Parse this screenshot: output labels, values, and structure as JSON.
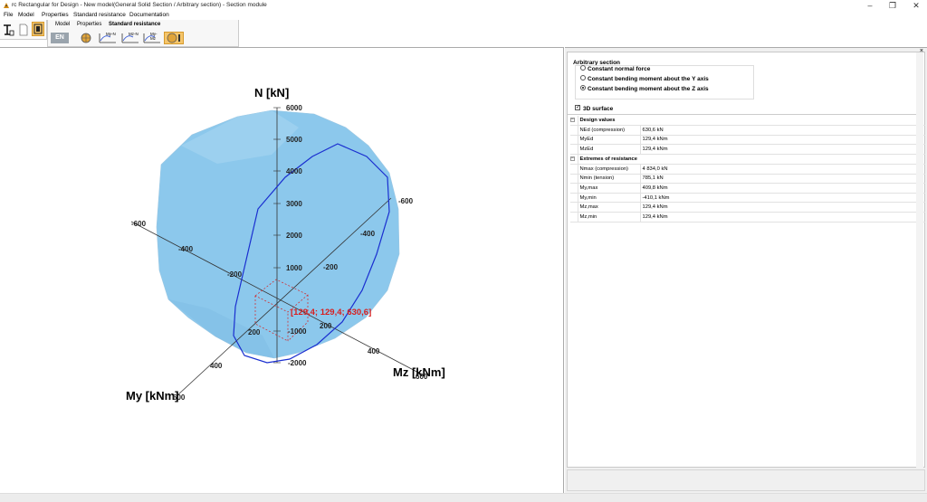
{
  "window": {
    "title": "rc Rectangular for Design - New model(General Solid Section / Arbitrary section) - Section module",
    "minimize": "–",
    "maximize": "❐",
    "close": "✕"
  },
  "menu": [
    "File",
    "Model",
    "Properties",
    "Standard resistance",
    "Documentation"
  ],
  "ribbon": {
    "tabs": [
      "Model",
      "Properties",
      "Standard resistance"
    ],
    "language": "EN",
    "icon_labels": [
      "My-N",
      "Mz-N",
      "My-Mz"
    ]
  },
  "chart": {
    "n_axis_label": "N [kN]",
    "my_axis_label": "My [kNm]",
    "mz_axis_label": "Mz [kNm]",
    "n_ticks": [
      "6000",
      "5000",
      "4000",
      "3000",
      "2000",
      "1000",
      "-1000",
      "-2000"
    ],
    "my_ticks": [
      "-600",
      "-400",
      "-200",
      "200",
      "400",
      "600"
    ],
    "mz_ticks": [
      "-600",
      "-400",
      "-200",
      "200",
      "400",
      "600"
    ],
    "point_label": "[129,4; 129,4; 630,6]",
    "surface_color": "#8cc8ec",
    "curve_color": "#1a2fd0",
    "point_color": "#d81e1e"
  },
  "panel": {
    "group_title": "Arbitrary section",
    "options": [
      {
        "label": "Constant normal force",
        "selected": false
      },
      {
        "label": "Constant bending moment about the Y axis",
        "selected": false
      },
      {
        "label": "Constant bending moment about the Z axis",
        "selected": true
      }
    ],
    "surface_check": {
      "label": "3D surface",
      "checked": true
    },
    "design_values": {
      "title": "Design values",
      "rows": [
        {
          "label": "NEd (compression)",
          "value": "630,6 kN"
        },
        {
          "label": "MyEd",
          "value": "129,4 kNm"
        },
        {
          "label": "MzEd",
          "value": "129,4 kNm"
        }
      ]
    },
    "extremes": {
      "title": "Extremes of resistance",
      "rows": [
        {
          "label": "Nmax (compression)",
          "value": "4 834,0 kN"
        },
        {
          "label": "Nmin (tension)",
          "value": "785,1 kN"
        },
        {
          "label": "My,max",
          "value": "409,8 kNm"
        },
        {
          "label": "My,min",
          "value": "-410,1 kNm"
        },
        {
          "label": "Mz,max",
          "value": "129,4 kNm"
        },
        {
          "label": "Mz,min",
          "value": "129,4 kNm"
        }
      ]
    },
    "panel_close": "×"
  }
}
